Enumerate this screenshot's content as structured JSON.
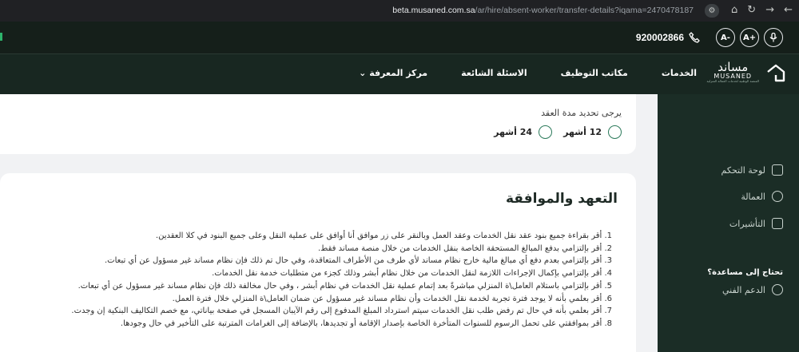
{
  "browser": {
    "url_host": "beta.musaned.com.sa",
    "url_path": "/ar/hire/absent-worker/transfer-details?iqama=2470478187",
    "nav_icons": [
      "back-icon",
      "forward-icon",
      "reload-icon",
      "home-icon",
      "site-settings-icon"
    ]
  },
  "utility": {
    "phone": "920002866",
    "font_increase": "+A",
    "font_decrease": "-A",
    "icons": [
      "microphone-icon",
      "phone-icon"
    ]
  },
  "header": {
    "logo_ar": "مساند",
    "logo_en": "MUSANED",
    "logo_sub": "المنصة الوطنية لخدمات العمالة المنزلية",
    "nav": [
      "الخدمات",
      "مكاتب التوظيف",
      "الاسئلة الشائعة",
      "مركز المعرفة"
    ],
    "knowledge_chevron": "⌄"
  },
  "sidebar": {
    "items": [
      {
        "label": "لوحة التحكم",
        "icon": "dashboard-icon"
      },
      {
        "label": "العمالة",
        "icon": "workers-icon"
      },
      {
        "label": "التأشيرات",
        "icon": "visa-icon"
      }
    ],
    "help_heading": "تحتاج إلى مساعدة؟",
    "support_label": "الدعم الفني",
    "support_icon": "support-icon"
  },
  "contract": {
    "prompt": "يرجى تحديد مدة العقد",
    "options": [
      "12 أشهر",
      "24 أشهر"
    ]
  },
  "terms": {
    "title": "التعهد والموافقة",
    "items": [
      "1. أقر بقراءة جميع بنود عقد نقل الخدمات وعقد العمل وبالنقر على زر موافق أنا أوافق على عملية النقل وعلى جميع البنود في كلا العقدين.",
      "2. أقر بإلتزامي بدفع المبالغ المستحقة الخاصة بنقل الخدمات من خلال منصة مساند فقط.",
      "3. أقر بإلتزامي بعدم دفع أي مبالغ مالية خارج نظام مساند لأي طرف من الأطراف المتعاقدة، وفي حال تم ذلك فإن نظام مساند غير مسؤول عن أي تبعات.",
      "4. أقر بإلتزامي بإكمال الإجراءات اللازمة لنقل الخدمات من خلال نظام أبشر وذلك كجزء من متطلبات خدمة نقل الخدمات.",
      "5. أقر بإلتزامي باستلام العامل\\ة المنزلي مباشرةً بعد إتمام عملية نقل الخدمات في نظام أبشر ، وفي حال مخالفة ذلك فإن نظام مساند غير مسؤول عن أي تبعات.",
      "6. أقر بعلمي بأنه لا يوجد فترة تجربة لخدمة نقل الخدمات وأن نظام مساند غير مسؤول عن ضمان العامل\\ة المنزلي خلال فترة العمل.",
      "7. أقر بعلمي بأنه في حال تم رفض طلب نقل الخدمات سيتم استرداد المبلغ المدفوع إلى رقم الآيبان المسجل في صفحة بياناتي، مع خصم التكاليف البنكية إن وجدت.",
      "8. أقر بموافقتي على تحمل الرسوم للسنوات المتأخرة الخاصة بإصدار الإقامة أو تجديدها، بالإضافة إلى الغرامات المترتبة على التأخير في حال وجودها."
    ]
  },
  "colors": {
    "nav_bg": "#182721",
    "sidebar_bg": "#1b2d26",
    "accent": "#2c7a5b"
  }
}
